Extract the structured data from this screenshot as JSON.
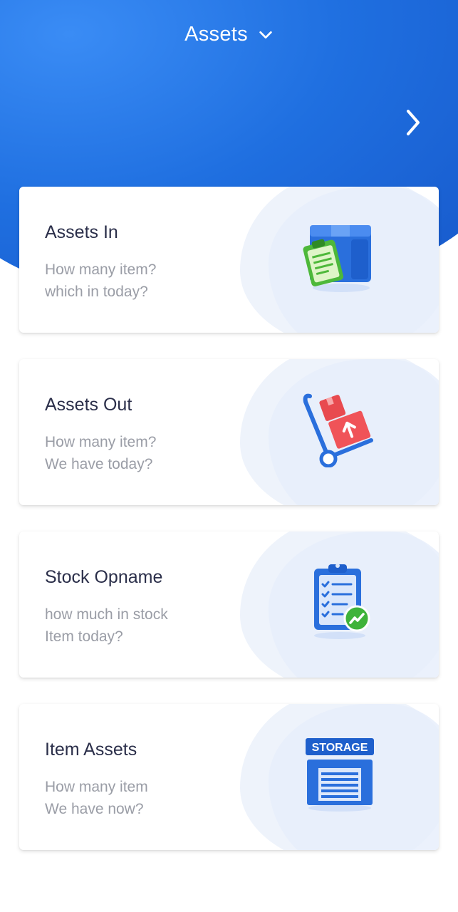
{
  "header": {
    "title": "Assets",
    "dropdown_icon": "chevron-down-icon",
    "next_icon": "chevron-right-icon",
    "colors": {
      "gradient_start": "#3a8cf5",
      "gradient_end": "#1656c8"
    }
  },
  "cards": [
    {
      "title": "Assets In",
      "line1": "How many item?",
      "line2": "which in today?",
      "icon": "box-clipboard-icon"
    },
    {
      "title": "Assets Out",
      "line1": "How many item?",
      "line2": "We have today?",
      "icon": "hand-truck-icon"
    },
    {
      "title": "Stock Opname",
      "line1": "how much in stock",
      "line2": "Item today?",
      "icon": "checklist-trend-icon"
    },
    {
      "title": "Item Assets",
      "line1": "How many item",
      "line2": "We have now?",
      "icon": "storage-icon",
      "icon_text": "STORAGE"
    }
  ]
}
